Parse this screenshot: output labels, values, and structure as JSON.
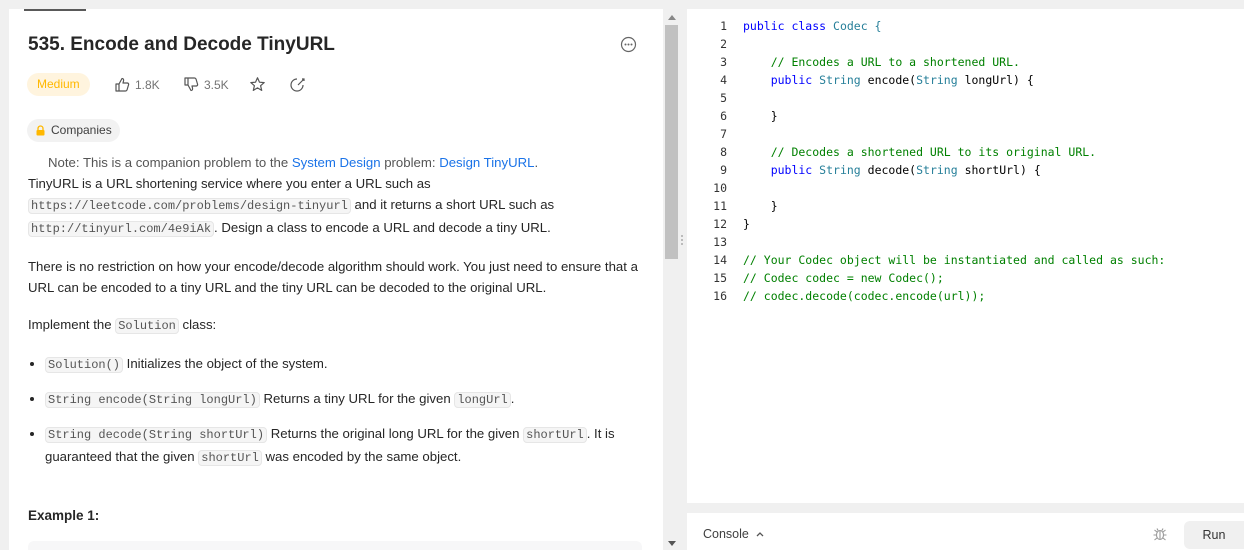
{
  "problem": {
    "title": "535. Encode and Decode TinyURL",
    "difficulty": "Medium",
    "likes": "1.8K",
    "dislikes": "3.5K",
    "companies_label": "Companies"
  },
  "description": {
    "note_prefix": "Note: This is a companion problem to the ",
    "note_link1": "System Design",
    "note_mid": " problem: ",
    "note_link2": "Design TinyURL",
    "note_end": ".",
    "p1_a": "TinyURL is a URL shortening service where you enter a URL such as",
    "p1_code1": "https://leetcode.com/problems/design-tinyurl",
    "p1_b": " and it returns a short URL such as",
    "p1_code2": "http://tinyurl.com/4e9iAk",
    "p1_c": ". Design a class to encode a URL and decode a tiny URL.",
    "p2": "There is no restriction on how your encode/decode algorithm should work. You just need to ensure that a URL can be encoded to a tiny URL and the tiny URL can be decoded to the original URL.",
    "p3_a": "Implement the ",
    "p3_code": "Solution",
    "p3_b": " class:",
    "bullets": [
      {
        "code": "Solution()",
        "text": " Initializes the object of the system."
      },
      {
        "code": "String encode(String longUrl)",
        "text": " Returns a tiny URL for the given ",
        "code2": "longUrl",
        "text2": "."
      },
      {
        "code": "String decode(String shortUrl)",
        "text": " Returns the original long URL for the given ",
        "code2": "shortUrl",
        "text2": ". It is guaranteed that the given ",
        "code3": "shortUrl",
        "text3": " was encoded by the same object."
      }
    ],
    "example_heading": "Example 1:"
  },
  "editor": {
    "line_numbers": [
      "1",
      "2",
      "3",
      "4",
      "5",
      "6",
      "7",
      "8",
      "9",
      "10",
      "11",
      "12",
      "13",
      "14",
      "15",
      "16"
    ],
    "l1_kw": "public class",
    "l1_name": " Codec {",
    "l3": "    // Encodes a URL to a shortened URL.",
    "l4_kw": "    public",
    "l4_tp": " String",
    "l4_a": " encode(",
    "l4_tp2": "String",
    "l4_b": " longUrl) {",
    "l6": "    }",
    "l8": "    // Decodes a shortened URL to its original URL.",
    "l9_kw": "    public",
    "l9_tp": " String",
    "l9_a": " decode(",
    "l9_tp2": "String",
    "l9_b": " shortUrl) {",
    "l11": "    }",
    "l12": "}",
    "l14": "// Your Codec object will be instantiated and called as such:",
    "l15": "// Codec codec = new Codec();",
    "l16": "// codec.decode(codec.encode(url));"
  },
  "console": {
    "label": "Console",
    "run_label": "Run"
  },
  "colors": {
    "medium": "#ffb800",
    "link": "#1a73e8",
    "comment": "#008000",
    "keyword": "#0000ff"
  }
}
